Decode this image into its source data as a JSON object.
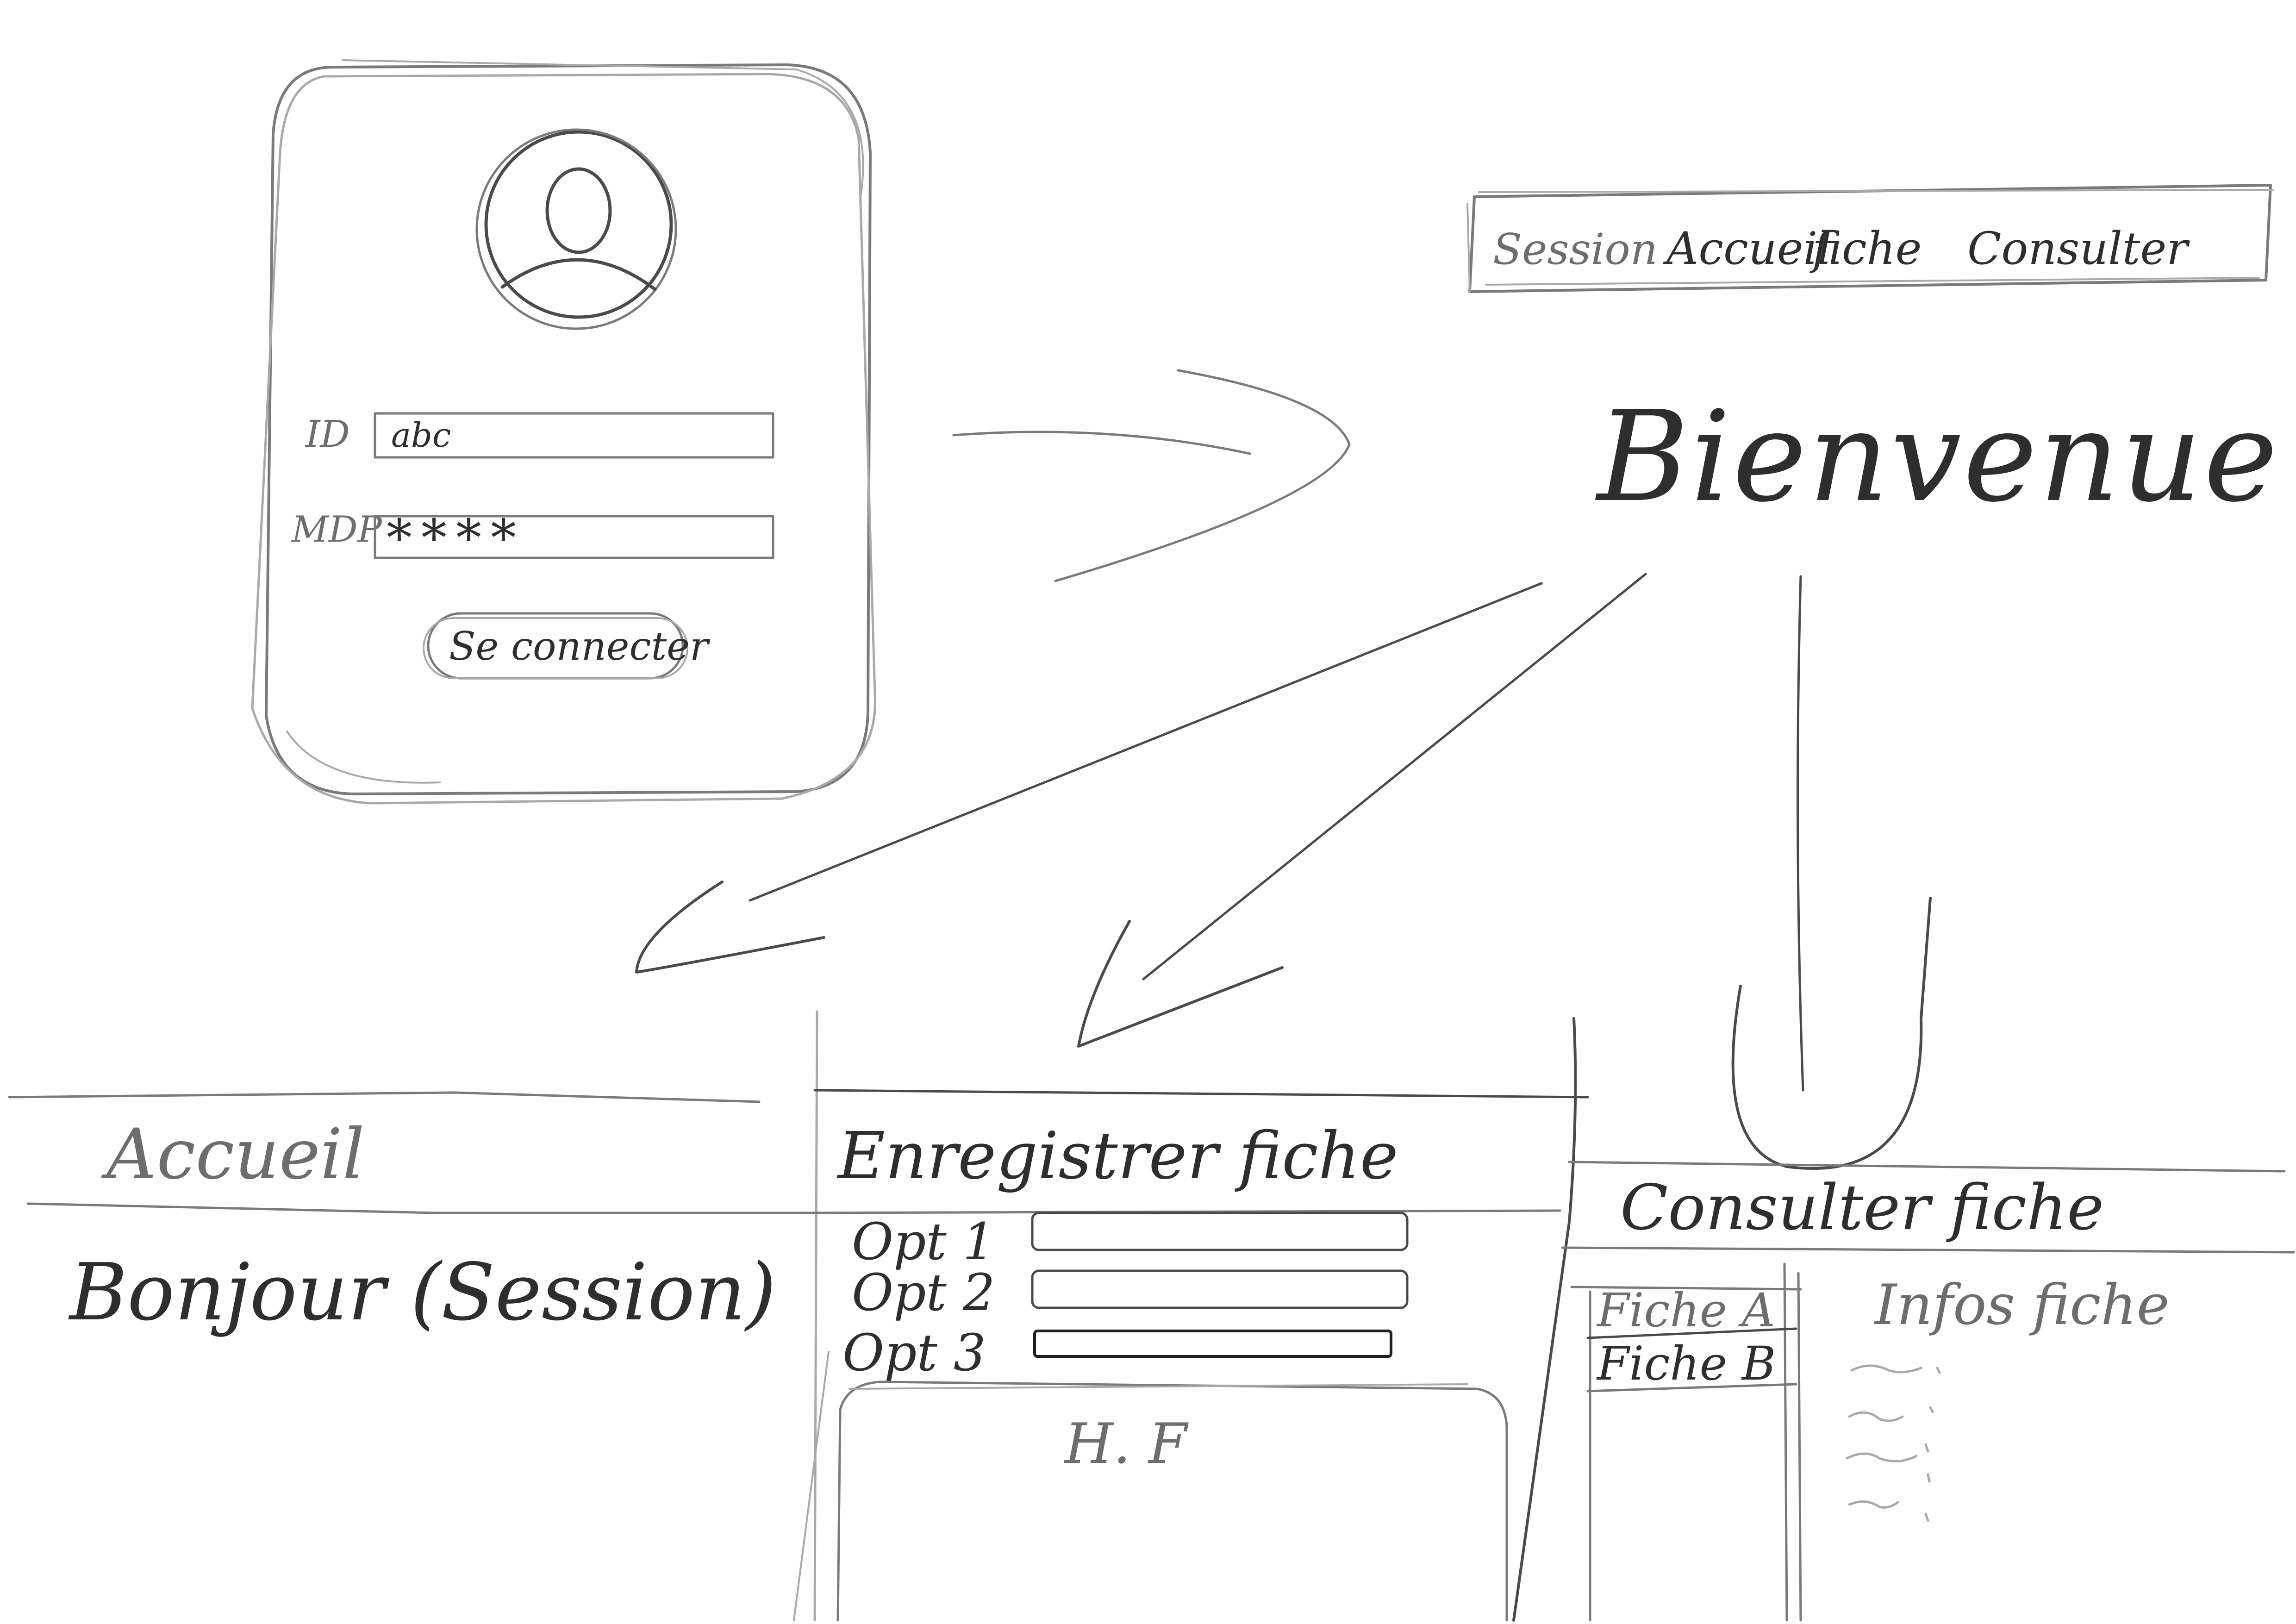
{
  "login": {
    "id_label": "ID",
    "id_value": "abc",
    "password_label": "MDP",
    "password_value": "****",
    "login_button": "Se connecter"
  },
  "navbar": {
    "items": [
      "Session",
      "Accueil",
      "fiche",
      "Consulter"
    ]
  },
  "welcome": {
    "title": "Bienvenue"
  },
  "accueil": {
    "header": "Accueil",
    "greeting": "Bonjour (Session)"
  },
  "enregistrer": {
    "header": "Enregistrer fiche",
    "options": [
      "Opt 1",
      "Opt 2",
      "Opt 3"
    ],
    "area_label": "H. F"
  },
  "consulter": {
    "header": "Consulter fiche",
    "list": [
      "Fiche A",
      "Fiche B"
    ],
    "info_title": "Infos fiche"
  }
}
